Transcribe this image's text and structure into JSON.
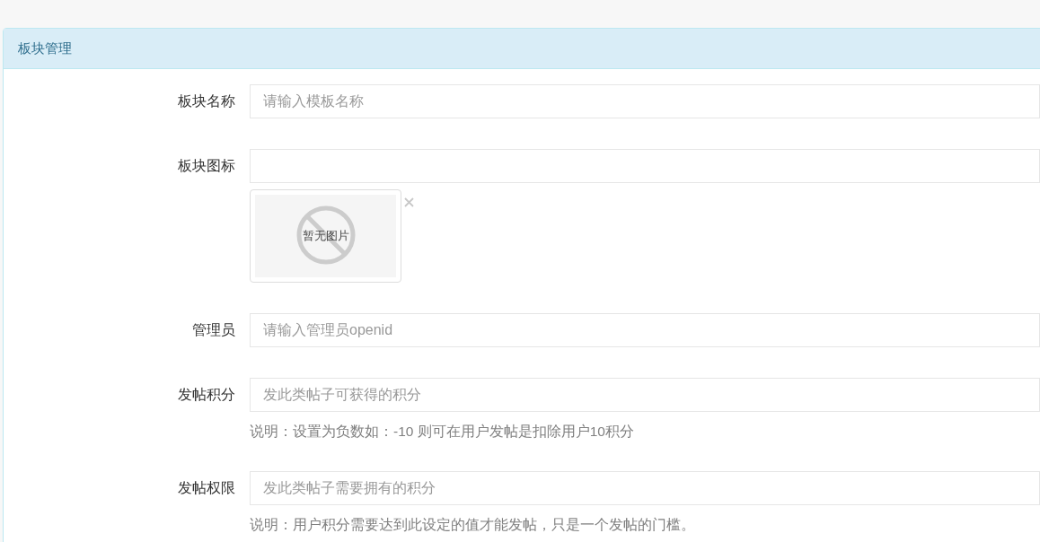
{
  "panel": {
    "title": "板块管理"
  },
  "fields": [
    {
      "kind": "text",
      "label": "板块名称",
      "placeholder": "请输入模板名称"
    },
    {
      "kind": "image",
      "label": "板块图标",
      "preview": {
        "text": "暂无图片"
      }
    },
    {
      "kind": "text",
      "label": "管理员",
      "placeholder": "请输入管理员openid"
    },
    {
      "kind": "text",
      "label": "发帖积分",
      "placeholder": "发此类帖子可获得的积分",
      "help": "说明：设置为负数如：-10 则可在用户发帖是扣除用户10积分"
    },
    {
      "kind": "text",
      "label": "发帖权限",
      "placeholder": "发此类帖子需要拥有的积分",
      "help": "说明：用户积分需要达到此设定的值才能发帖，只是一个发帖的门槛。"
    }
  ]
}
